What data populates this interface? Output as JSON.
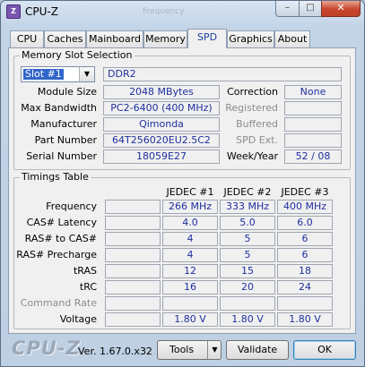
{
  "window": {
    "title": "CPU-Z",
    "app_icon_text": "Z",
    "ghost_title": "Frequency",
    "controls": {
      "minimize": "–",
      "maximize": "□",
      "close": "✕"
    }
  },
  "tabs": [
    "CPU",
    "Caches",
    "Mainboard",
    "Memory",
    "SPD",
    "Graphics",
    "About"
  ],
  "active_tab": "SPD",
  "memory_slot": {
    "group_title": "Memory Slot Selection",
    "slot_value": "Slot #1",
    "type": "DDR2",
    "left_rows": [
      {
        "label": "Module Size",
        "value": "2048 MBytes"
      },
      {
        "label": "Max Bandwidth",
        "value": "PC2-6400 (400 MHz)"
      },
      {
        "label": "Manufacturer",
        "value": "Qimonda"
      },
      {
        "label": "Part Number",
        "value": "64T256020EU2.5C2"
      },
      {
        "label": "Serial Number",
        "value": "18059E27"
      }
    ],
    "right_rows": [
      {
        "label": "Correction",
        "value": "None",
        "enabled": true
      },
      {
        "label": "Registered",
        "value": "",
        "enabled": false
      },
      {
        "label": "Buffered",
        "value": "",
        "enabled": false
      },
      {
        "label": "SPD Ext.",
        "value": "",
        "enabled": false
      },
      {
        "label": "Week/Year",
        "value": "52 / 08",
        "enabled": true
      }
    ]
  },
  "timings": {
    "group_title": "Timings Table",
    "columns": [
      "JEDEC #1",
      "JEDEC #2",
      "JEDEC #3"
    ],
    "rows": [
      {
        "label": "Frequency",
        "values": [
          "266 MHz",
          "333 MHz",
          "400 MHz"
        ],
        "enabled": true
      },
      {
        "label": "CAS# Latency",
        "values": [
          "4.0",
          "5.0",
          "6.0"
        ],
        "enabled": true
      },
      {
        "label": "RAS# to CAS#",
        "values": [
          "4",
          "5",
          "6"
        ],
        "enabled": true
      },
      {
        "label": "RAS# Precharge",
        "values": [
          "4",
          "5",
          "6"
        ],
        "enabled": true
      },
      {
        "label": "tRAS",
        "values": [
          "12",
          "15",
          "18"
        ],
        "enabled": true
      },
      {
        "label": "tRC",
        "values": [
          "16",
          "20",
          "24"
        ],
        "enabled": true
      },
      {
        "label": "Command Rate",
        "values": [
          "",
          "",
          ""
        ],
        "enabled": false
      },
      {
        "label": "Voltage",
        "values": [
          "1.80 V",
          "1.80 V",
          "1.80 V"
        ],
        "enabled": true
      }
    ]
  },
  "footer": {
    "logo": "CPU-Z",
    "version": "Ver. 1.67.0.x32",
    "tools_label": "Tools",
    "validate_label": "Validate",
    "ok_label": "OK"
  }
}
